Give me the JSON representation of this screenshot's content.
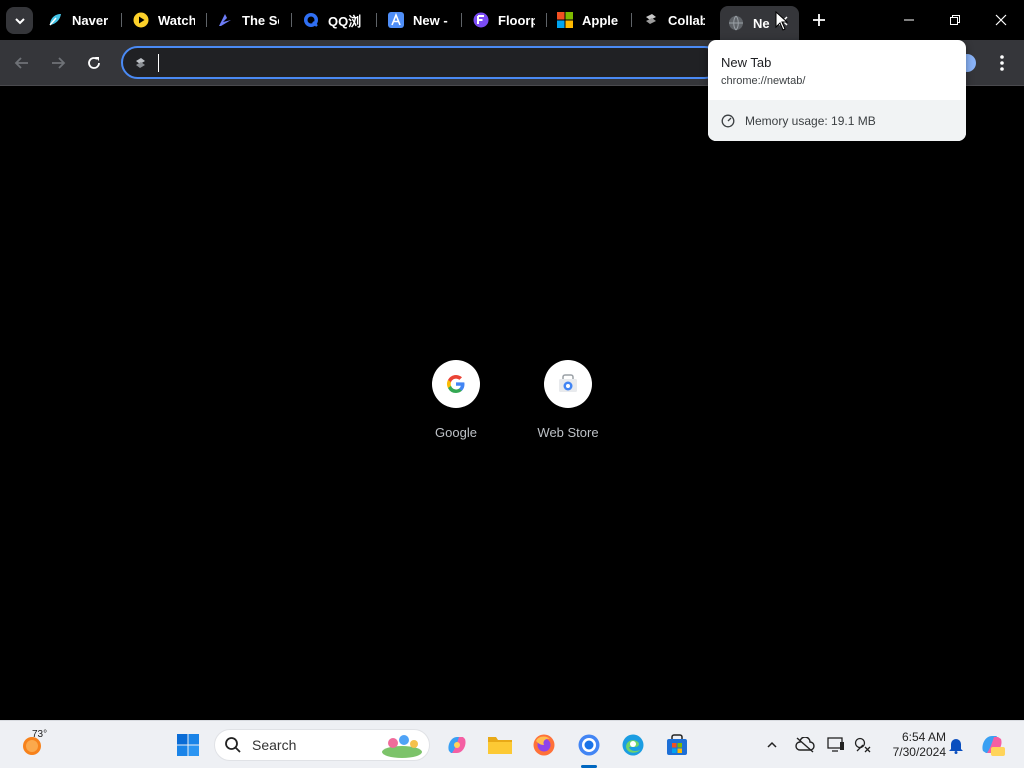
{
  "tabs": [
    {
      "title": "Naver",
      "icon": "naver-icon"
    },
    {
      "title": "Watch",
      "icon": "play-icon"
    },
    {
      "title": "The Se",
      "icon": "arc-icon"
    },
    {
      "title": "QQ浏",
      "icon": "qq-icon"
    },
    {
      "title": "New -",
      "icon": "a-icon"
    },
    {
      "title": "Floorp",
      "icon": "floorp-icon"
    },
    {
      "title": "Apple",
      "icon": "microsoft-icon"
    },
    {
      "title": "Collab",
      "icon": "collab-icon"
    },
    {
      "title": "Ne",
      "icon": "globe-icon",
      "active": true
    }
  ],
  "omnibox": {
    "value": "",
    "placeholder": ""
  },
  "hovercard": {
    "title": "New Tab",
    "url": "chrome://newtab/",
    "memory": "Memory usage: 19.1 MB"
  },
  "shortcuts": [
    {
      "label": "Google",
      "icon": "google-icon"
    },
    {
      "label": "Web Store",
      "icon": "web-store-icon"
    }
  ],
  "taskbar": {
    "weather_temp": "73°",
    "search_label": "Search",
    "time": "6:54 AM",
    "date": "7/30/2024"
  },
  "colors": {
    "accent": "#4a8af4",
    "toolbar_bg": "#35363a",
    "page_bg": "#000000",
    "taskbar_bg": "#eef0f4"
  }
}
